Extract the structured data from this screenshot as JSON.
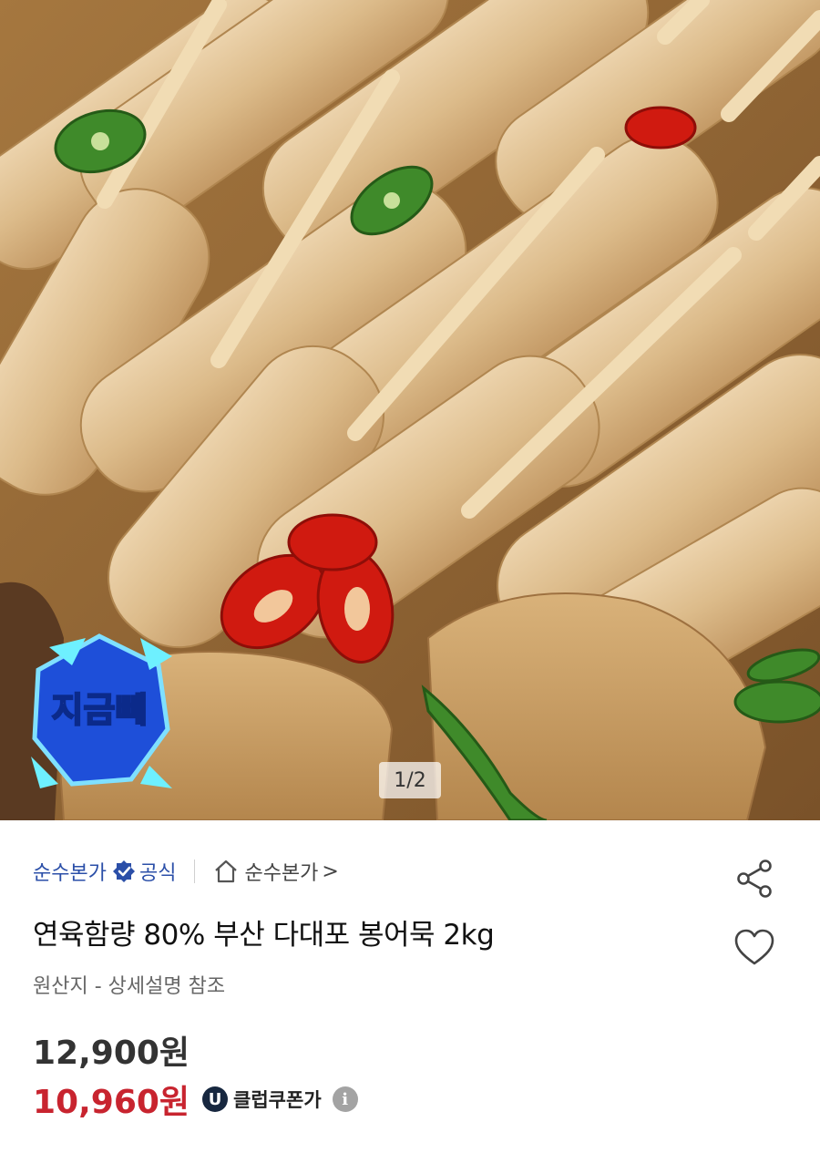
{
  "product_image": {
    "counter": "1/2",
    "badge_text": "지금뻬"
  },
  "seller": {
    "name": "순수본가",
    "official_label": "공식",
    "store_link": "순수본가",
    "store_link_chevron": ">"
  },
  "product": {
    "title": "연육함량 80% 부산 다대포 봉어묵 2kg",
    "origin": "원산지 - 상세설명 참조"
  },
  "pricing": {
    "original_price": "12,900원",
    "sale_price": "10,960원",
    "coupon_badge": "U",
    "coupon_label": "클럽쿠폰가",
    "info_icon": "i"
  },
  "icons": {
    "share": "share-icon",
    "wishlist": "heart-icon",
    "verified": "verified-check-icon",
    "home": "home-icon",
    "info": "info-icon"
  },
  "colors": {
    "seller_blue": "#2b4fa8",
    "sale_red": "#c8242f",
    "coupon_navy": "#17273f"
  }
}
